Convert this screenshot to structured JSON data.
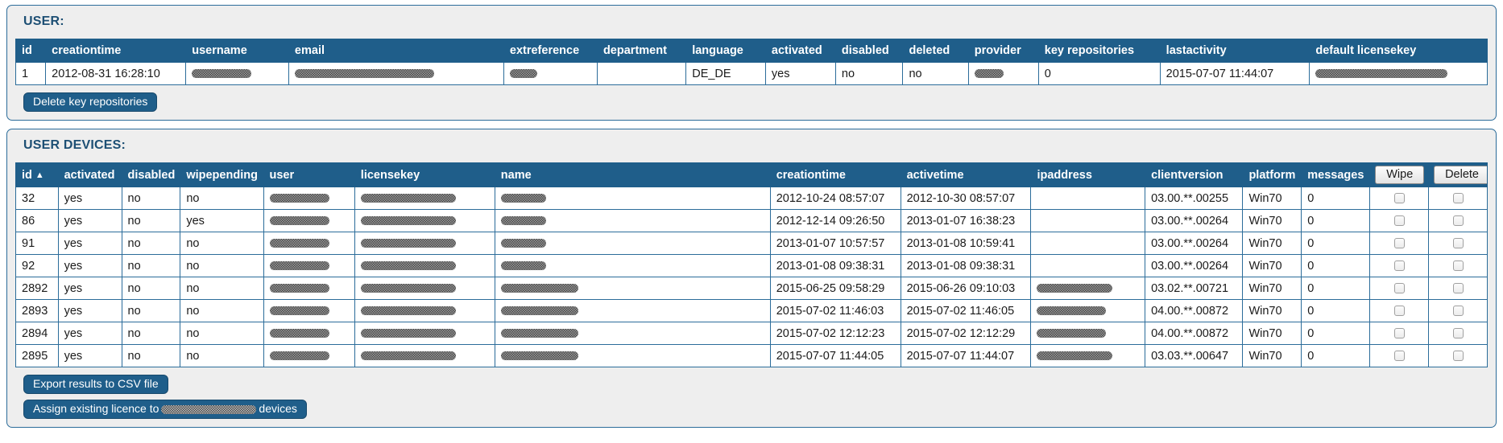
{
  "user_panel": {
    "title": "USER:",
    "columns": [
      "id",
      "creationtime",
      "username",
      "email",
      "extreference",
      "department",
      "language",
      "activated",
      "disabled",
      "deleted",
      "provider",
      "key repositories",
      "lastactivity",
      "default licensekey"
    ],
    "rows": [
      {
        "id": "1",
        "creationtime": "2012-08-31 16:28:10",
        "username": "",
        "email": "",
        "extreference": "",
        "department": "",
        "language": "DE_DE",
        "activated": "yes",
        "disabled": "no",
        "deleted": "no",
        "provider": "",
        "key_repositories": "0",
        "lastactivity": "2015-07-07 11:44:07",
        "default_licensekey": ""
      }
    ],
    "delete_key_repositories_label": "Delete key repositories"
  },
  "devices_panel": {
    "title": "USER DEVICES:",
    "columns": {
      "id": "id",
      "id_sort_arrow": "▲",
      "activated": "activated",
      "disabled": "disabled",
      "wipepending": "wipepending",
      "user": "user",
      "licensekey": "licensekey",
      "name": "name",
      "creationtime": "creationtime",
      "activetime": "activetime",
      "ipaddress": "ipaddress",
      "clientversion": "clientversion",
      "platform": "platform",
      "messages": "messages",
      "wipe_button": "Wipe",
      "delete_button": "Delete"
    },
    "rows": [
      {
        "id": "32",
        "activated": "yes",
        "disabled": "no",
        "wipepending": "no",
        "creationtime": "2012-10-24 08:57:07",
        "activetime": "2012-10-30 08:57:07",
        "ipaddress": "",
        "clientversion": "03.00.**.00255",
        "platform": "Win70",
        "messages": "0"
      },
      {
        "id": "86",
        "activated": "yes",
        "disabled": "no",
        "wipepending": "yes",
        "creationtime": "2012-12-14 09:26:50",
        "activetime": "2013-01-07 16:38:23",
        "ipaddress": "",
        "clientversion": "03.00.**.00264",
        "platform": "Win70",
        "messages": "0"
      },
      {
        "id": "91",
        "activated": "yes",
        "disabled": "no",
        "wipepending": "no",
        "creationtime": "2013-01-07 10:57:57",
        "activetime": "2013-01-08 10:59:41",
        "ipaddress": "",
        "clientversion": "03.00.**.00264",
        "platform": "Win70",
        "messages": "0"
      },
      {
        "id": "92",
        "activated": "yes",
        "disabled": "no",
        "wipepending": "no",
        "creationtime": "2013-01-08 09:38:31",
        "activetime": "2013-01-08 09:38:31",
        "ipaddress": "",
        "clientversion": "03.00.**.00264",
        "platform": "Win70",
        "messages": "0"
      },
      {
        "id": "2892",
        "activated": "yes",
        "disabled": "no",
        "wipepending": "no",
        "creationtime": "2015-06-25 09:58:29",
        "activetime": "2015-06-26 09:10:03",
        "ipaddress": "",
        "clientversion": "03.02.**.00721",
        "platform": "Win70",
        "messages": "0"
      },
      {
        "id": "2893",
        "activated": "yes",
        "disabled": "no",
        "wipepending": "no",
        "creationtime": "2015-07-02 11:46:03",
        "activetime": "2015-07-02 11:46:05",
        "ipaddress": "",
        "clientversion": "04.00.**.00872",
        "platform": "Win70",
        "messages": "0"
      },
      {
        "id": "2894",
        "activated": "yes",
        "disabled": "no",
        "wipepending": "no",
        "creationtime": "2015-07-02 12:12:23",
        "activetime": "2015-07-02 12:12:29",
        "ipaddress": "",
        "clientversion": "04.00.**.00872",
        "platform": "Win70",
        "messages": "0"
      },
      {
        "id": "2895",
        "activated": "yes",
        "disabled": "no",
        "wipepending": "no",
        "creationtime": "2015-07-07 11:44:05",
        "activetime": "2015-07-07 11:44:07",
        "ipaddress": "",
        "clientversion": "03.03.**.00647",
        "platform": "Win70",
        "messages": "0"
      }
    ],
    "export_csv_label": "Export results to CSV file",
    "assign_licence_prefix": "Assign existing licence to",
    "assign_licence_suffix": "devices"
  },
  "colors": {
    "header_blue": "#1f5e8a",
    "border_blue": "#2b6c9a",
    "title_blue": "#1d4f74",
    "panel_bg": "#eeeeee"
  }
}
